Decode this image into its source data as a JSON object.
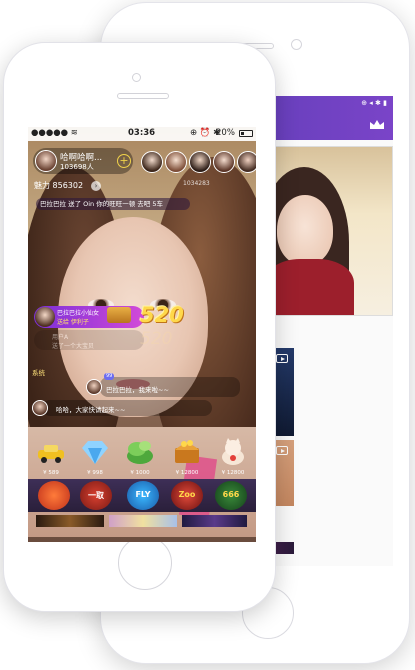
{
  "status_bar": {
    "time": "03:36",
    "battery": "20%"
  },
  "host": {
    "name": "哈啊哈啊...",
    "audience_count": "103698人",
    "follow_icon": "plus-icon"
  },
  "charm": {
    "label": "魅力 856302"
  },
  "room_id": "1034283",
  "ticker": {
    "text": "巴拉巴拉 送了 Oin 你的旺旺一顿  去吧  5车"
  },
  "gift_combo": {
    "sender": "巴拉巴拉小仙女",
    "gift_text": "送给 伊利子",
    "combo_count": "520",
    "ghost_sender": "用户A",
    "ghost_text": "送了一个大宝贝",
    "ghost_combo": "520"
  },
  "chat": {
    "system_label": "系统",
    "level_badge": "99",
    "message_1": "巴拉巴拉，我来啦~~",
    "message_2": "哈哈，大家快请起来~~"
  },
  "gift_shelf": [
    {
      "name": "car-gift-icon",
      "price": "¥ 589"
    },
    {
      "name": "diamond-gift-icon",
      "price": "¥ 998"
    },
    {
      "name": "money-gift-icon",
      "price": "¥ 1000"
    },
    {
      "name": "treasure-gift-icon",
      "price": "¥ 12800"
    },
    {
      "name": "lucky-cat-gift-icon",
      "price": "¥ 12800"
    }
  ],
  "game_bar": [
    {
      "name": "car-game-icon",
      "label": ""
    },
    {
      "name": "fly-game-icon",
      "label": "FLY"
    },
    {
      "name": "win-game-icon",
      "label": "Zoo"
    },
    {
      "name": "lucky-666-game-icon",
      "label": "666"
    }
  ],
  "colors": {
    "purple_header": "#6b40c0",
    "combo_gold": "#ffd84a",
    "gift_banner_start": "#7b2fd8",
    "gift_banner_end": "#d24ad8"
  }
}
